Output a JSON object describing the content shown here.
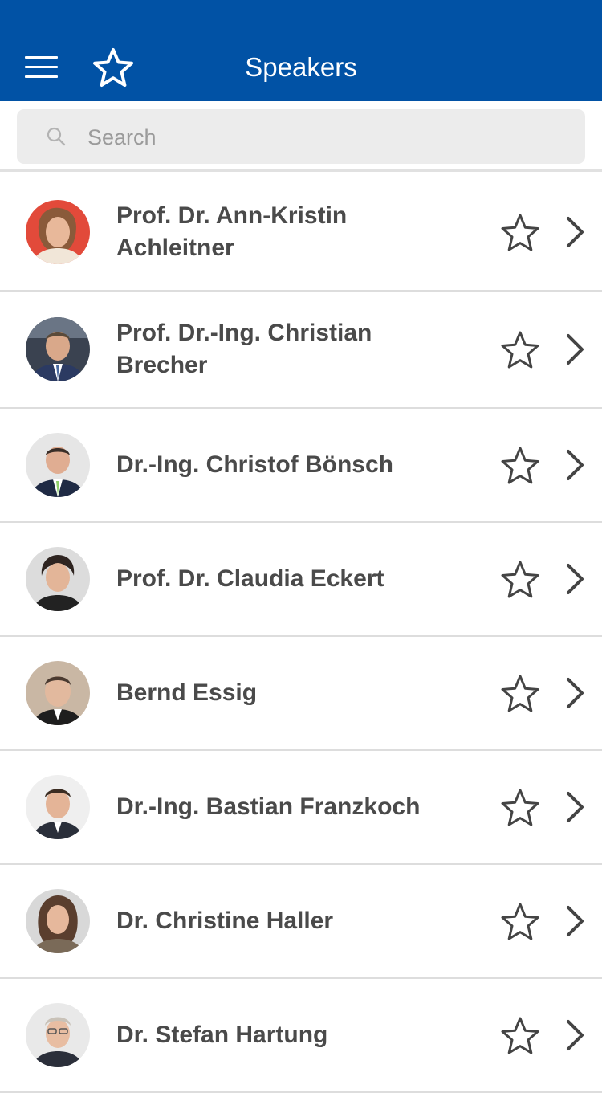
{
  "header": {
    "title": "Speakers",
    "menu_icon": "hamburger-menu-icon",
    "favorites_icon": "star-icon",
    "background_color": "#0152a5"
  },
  "search": {
    "placeholder": "Search",
    "value": "",
    "icon": "search-icon"
  },
  "speakers": [
    {
      "name": "Prof. Dr. Ann-Kristin Achleitner",
      "favorite": false
    },
    {
      "name": "Prof. Dr.-Ing. Christian Brecher",
      "favorite": false
    },
    {
      "name": "Dr.-Ing. Christof Bönsch",
      "favorite": false
    },
    {
      "name": "Prof. Dr. Claudia Eckert",
      "favorite": false
    },
    {
      "name": "Bernd Essig",
      "favorite": false
    },
    {
      "name": "Dr.-Ing. Bastian Franzkoch",
      "favorite": false
    },
    {
      "name": "Dr. Christine Haller",
      "favorite": false
    },
    {
      "name": "Dr. Stefan Hartung",
      "favorite": false
    }
  ],
  "colors": {
    "name_text": "#4a4a4a",
    "icon_gray": "#444444",
    "divider": "#dddddd"
  }
}
